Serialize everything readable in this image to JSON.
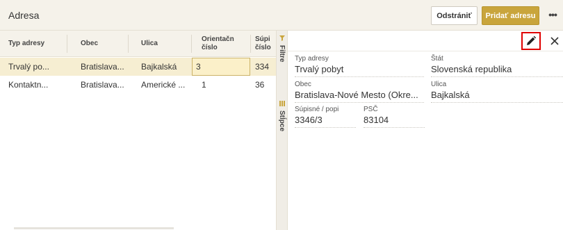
{
  "header": {
    "title": "Adresa",
    "remove_label": "Odstrániť",
    "add_label": "Pridať adresu",
    "more_label": "•••"
  },
  "grid": {
    "columns": [
      "Typ adresy",
      "Obec",
      "Ulica",
      "Orientačn číslo",
      "Súpi číslo"
    ],
    "rows": [
      {
        "typ": "Trvalý po...",
        "obec": "Bratislava...",
        "ulica": "Bajkalská",
        "orient": "3",
        "supis": "334"
      },
      {
        "typ": "Kontaktn...",
        "obec": "Bratislava...",
        "ulica": "Americké ...",
        "orient": "1",
        "supis": "36"
      }
    ]
  },
  "sidebar": {
    "filters_label": "Filtre",
    "columns_label": "Stĺpce"
  },
  "detail": {
    "fields": [
      {
        "label": "Typ adresy",
        "value": "Trvalý pobyt"
      },
      {
        "label": "Štát",
        "value": "Slovenská republika"
      },
      {
        "label": "Obec",
        "value": "Bratislava-Nové Mesto (Okre..."
      },
      {
        "label": "Ulica",
        "value": "Bajkalská"
      },
      {
        "label": "Súpisné / popi",
        "value": "3346/3"
      },
      {
        "label": "PSČ",
        "value": "83104"
      }
    ]
  },
  "colors": {
    "accent": "#c9a53c",
    "header_bg": "#f5f2ea",
    "selected_row": "#f6eed2",
    "highlight_border": "#e00000"
  },
  "icons": {
    "edit": "pencil-icon",
    "close": "close-icon",
    "filter": "filter-icon",
    "columns": "columns-icon",
    "more": "more-icon"
  }
}
